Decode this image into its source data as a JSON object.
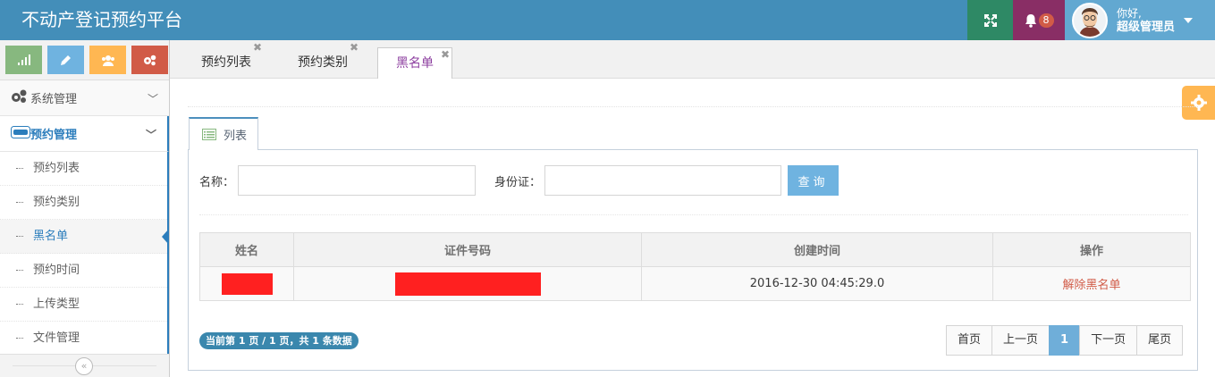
{
  "app": {
    "title": "不动产登记预约平台"
  },
  "header": {
    "notification_count": "8",
    "greeting": "你好,",
    "username": "超级管理员",
    "colors": {
      "bar": "#438eb9",
      "fullscreen": "#2e8965",
      "bell": "#892e65",
      "user": "#62a8d1"
    }
  },
  "shortcuts": [
    {
      "icon": "signal-icon",
      "color": "#87b87f"
    },
    {
      "icon": "pencil-icon",
      "color": "#6fb3e0"
    },
    {
      "icon": "users-icon",
      "color": "#ffb752"
    },
    {
      "icon": "cogs-icon",
      "color": "#d15b47"
    }
  ],
  "sidebar": {
    "menus": [
      {
        "label": "系统管理",
        "icon": "cogs-icon",
        "expanded": false
      },
      {
        "label": "预约管理",
        "icon": "card-icon",
        "expanded": true
      }
    ],
    "sub_items": [
      {
        "label": "预约列表"
      },
      {
        "label": "预约类别"
      },
      {
        "label": "黑名单",
        "active": true
      },
      {
        "label": "预约时间"
      },
      {
        "label": "上传类型"
      },
      {
        "label": "文件管理"
      }
    ],
    "collapse_glyph": "«"
  },
  "tabs": [
    {
      "label": "预约列表",
      "active": false
    },
    {
      "label": "预约类别",
      "active": false
    },
    {
      "label": "黑名单",
      "active": true
    }
  ],
  "widget": {
    "tab_label": "列表"
  },
  "search": {
    "name_label": "名称：",
    "name_value": "",
    "id_label": "身份证：",
    "id_value": "",
    "query_button": "查询"
  },
  "table": {
    "columns": [
      "姓名",
      "证件号码",
      "创建时间",
      "操作"
    ],
    "rows": [
      {
        "name": "",
        "id_number": "",
        "created": "2016-12-30 04:45:29.0",
        "action": "解除黑名单"
      }
    ]
  },
  "pagination": {
    "info": "当前第 1 页 / 1 页，共 1 条数据",
    "first": "首页",
    "prev": "上一页",
    "current": "1",
    "next": "下一页",
    "last": "尾页"
  }
}
